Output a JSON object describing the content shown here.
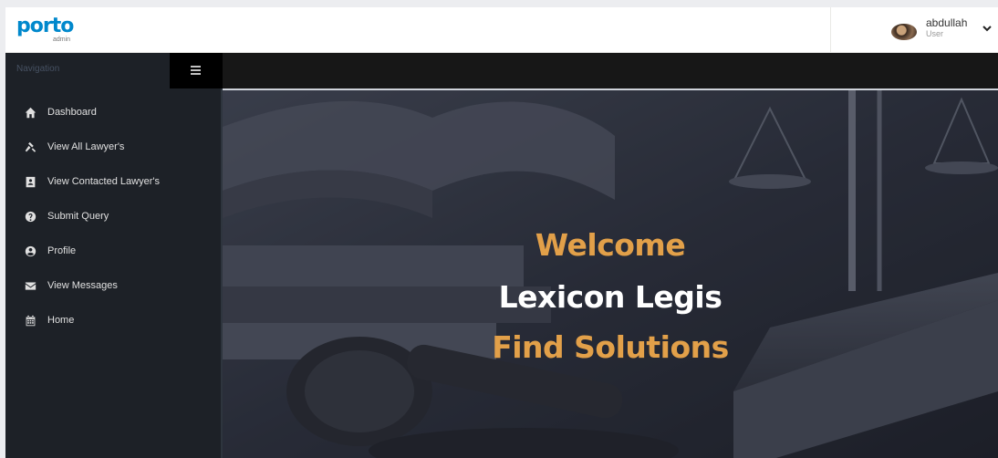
{
  "header": {
    "logo_text": "porto",
    "logo_sub": "admin",
    "user": {
      "name": "abdullah",
      "role": "User"
    }
  },
  "sidebar": {
    "nav_title": "Navigation",
    "items": [
      {
        "label": "Dashboard",
        "icon": "home-icon"
      },
      {
        "label": "View All Lawyer's",
        "icon": "gavel-icon"
      },
      {
        "label": "View Contacted Lawyer's",
        "icon": "address-book-icon"
      },
      {
        "label": "Submit Query",
        "icon": "question-circle-icon"
      },
      {
        "label": "Profile",
        "icon": "user-circle-icon"
      },
      {
        "label": "View Messages",
        "icon": "envelope-icon"
      },
      {
        "label": "Home",
        "icon": "calendar-icon"
      }
    ]
  },
  "hero": {
    "line1": "Welcome",
    "line2": "Lexicon Legis",
    "line3": "Find Solutions"
  },
  "colors": {
    "brand": "#0088cc",
    "sidebar_bg": "#1d2127",
    "accent_gold": "#e2a049"
  }
}
